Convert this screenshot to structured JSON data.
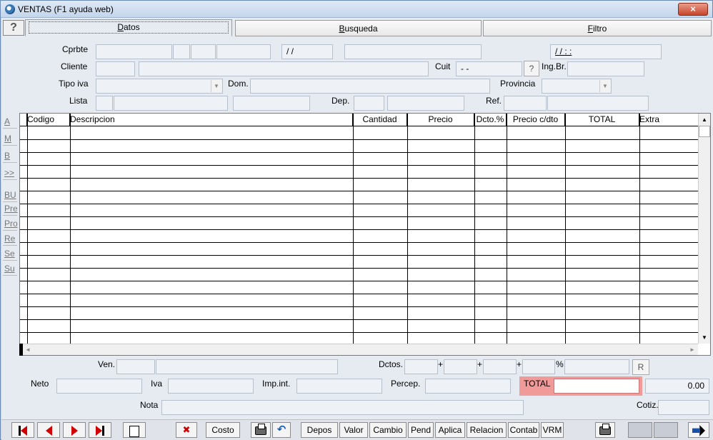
{
  "window": {
    "title": "VENTAS (F1 ayuda web)",
    "close_glyph": "×"
  },
  "help": {
    "glyph": "?"
  },
  "tabs": [
    {
      "key": "D",
      "rest": "atos"
    },
    {
      "key": "B",
      "rest": "usqueda"
    },
    {
      "key": "F",
      "rest": "iltro"
    }
  ],
  "form": {
    "cprbte_label": "Cprbte",
    "cprbte_date": " / /",
    "cprbte_datetime": " / /       :  :",
    "cliente_label": "Cliente",
    "cuit_label": "Cuit",
    "cuit_value": " -          -",
    "cuit_help": "?",
    "ingbr_label": "Ing.Br.",
    "tipoiva_label": "Tipo iva",
    "dom_label": "Dom.",
    "provincia_label": "Provincia",
    "lista_label": "Lista",
    "dep_label": "Dep.",
    "ref_label": "Ref."
  },
  "side_buttons": [
    "A",
    "M",
    "B",
    ">>",
    "BU",
    "Pre",
    "Pro",
    "Re",
    "Se",
    "Su"
  ],
  "grid": {
    "columns": [
      "Codigo",
      "Descripcion",
      "Cantidad",
      "Precio",
      "Dcto.%",
      "Precio c/dto",
      "TOTAL",
      "Extra"
    ]
  },
  "footer": {
    "ven_label": "Ven.",
    "dctos_label": "Dctos.",
    "plus": "+",
    "percent": "%",
    "r_button": "R",
    "neto_label": "Neto",
    "iva_label": "Iva",
    "impint_label": "Imp.int.",
    "percep_label": "Percep.",
    "total_label": "TOTAL",
    "total_value": "0.00",
    "nota_label": "Nota",
    "cotiz_label": "Cotiz."
  },
  "toolbar": {
    "costo": "Costo",
    "depos": "Depos",
    "valor": "Valor",
    "cambio": "Cambio",
    "pend": "Pend",
    "aplica": "Aplica",
    "relacion": "Relacion",
    "contab": "Contab",
    "vrm": "VRM"
  }
}
